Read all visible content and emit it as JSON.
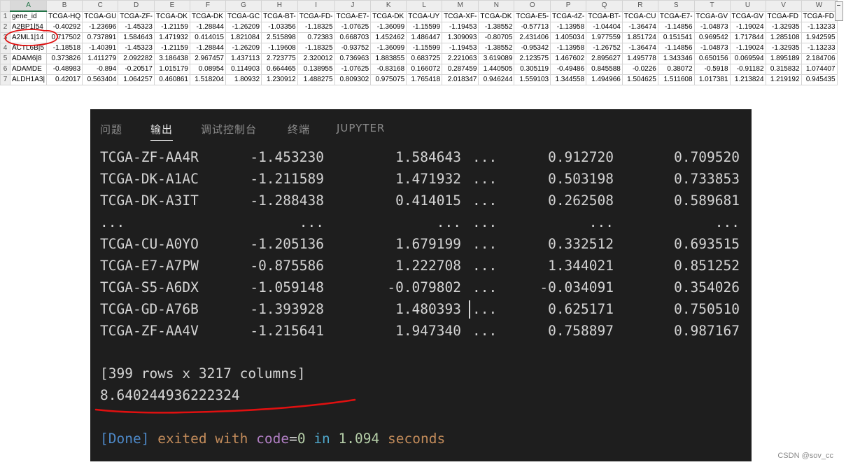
{
  "spreadsheet": {
    "columns": [
      "A",
      "B",
      "C",
      "D",
      "E",
      "F",
      "G",
      "H",
      "I",
      "J",
      "K",
      "L",
      "M",
      "N",
      "O",
      "P",
      "Q",
      "R",
      "S",
      "T",
      "U",
      "V",
      "W"
    ],
    "rows": [
      {
        "n": "1",
        "cells": [
          "gene_id",
          "TCGA-HQ",
          "TCGA-GU",
          "TCGA-ZF-",
          "TCGA-DK",
          "TCGA-DK",
          "TCGA-GC",
          "TCGA-BT-",
          "TCGA-FD-",
          "TCGA-E7-",
          "TCGA-DK",
          "TCGA-UY",
          "TCGA-XF-",
          "TCGA-DK",
          "TCGA-E5-",
          "TCGA-4Z-",
          "TCGA-BT-",
          "TCGA-CU",
          "TCGA-E7-",
          "TCGA-GV",
          "TCGA-GV",
          "TCGA-FD",
          "TCGA-FD"
        ]
      },
      {
        "n": "2",
        "cells": [
          "A2BP1|54",
          "-0.40292",
          "-1.23696",
          "-1.45323",
          "-1.21159",
          "-1.28844",
          "-1.26209",
          "-1.03356",
          "-1.18325",
          "-1.07625",
          "-1.36099",
          "-1.15599",
          "-1.19453",
          "-1.38552",
          "-0.57713",
          "-1.13958",
          "-1.04404",
          "-1.36474",
          "-1.14856",
          "-1.04873",
          "-1.19024",
          "-1.32935",
          "-1.13233"
        ]
      },
      {
        "n": "3",
        "cells": [
          "A2ML1|14",
          "0.717502",
          "0.737891",
          "1.584643",
          "1.471932",
          "0.414015",
          "1.821084",
          "2.515898",
          "0.72383",
          "0.668703",
          "1.452462",
          "1.486447",
          "1.309093",
          "-0.80705",
          "2.431406",
          "1.405034",
          "1.977559",
          "1.851724",
          "0.151541",
          "0.969542",
          "1.717844",
          "1.285108",
          "1.942595"
        ]
      },
      {
        "n": "4",
        "cells": [
          "ACTL6B|5",
          "-1.18518",
          "-1.40391",
          "-1.45323",
          "-1.21159",
          "-1.28844",
          "-1.26209",
          "-1.19608",
          "-1.18325",
          "-0.93752",
          "-1.36099",
          "-1.15599",
          "-1.19453",
          "-1.38552",
          "-0.95342",
          "-1.13958",
          "-1.26752",
          "-1.36474",
          "-1.14856",
          "-1.04873",
          "-1.19024",
          "-1.32935",
          "-1.13233"
        ]
      },
      {
        "n": "5",
        "cells": [
          "ADAM6|8",
          "0.373826",
          "1.411279",
          "2.092282",
          "3.186438",
          "2.967457",
          "1.437113",
          "2.723775",
          "2.320012",
          "0.736963",
          "1.883855",
          "0.683725",
          "2.221063",
          "3.619089",
          "2.123575",
          "1.467602",
          "2.895627",
          "1.495778",
          "1.343346",
          "0.650156",
          "0.069594",
          "1.895189",
          "2.184706"
        ]
      },
      {
        "n": "6",
        "cells": [
          "ADAMDE",
          "-0.48983",
          "-0.894",
          "-0.20517",
          "1.015179",
          "0.08954",
          "0.114903",
          "0.664465",
          "0.138955",
          "-1.07625",
          "-0.83168",
          "0.166072",
          "0.287459",
          "1.440505",
          "0.305119",
          "-0.49486",
          "0.845588",
          "-0.0226",
          "0.38072",
          "-0.5918",
          "-0.91182",
          "0.315832",
          "1.074407"
        ]
      },
      {
        "n": "7",
        "cells": [
          "ALDH1A3|",
          "0.42017",
          "0.563404",
          "1.064257",
          "0.460861",
          "1.518204",
          "1.80932",
          "1.230912",
          "1.488275",
          "0.809302",
          "0.975075",
          "1.765418",
          "2.018347",
          "0.946244",
          "1.559103",
          "1.344558",
          "1.494966",
          "1.504625",
          "1.511608",
          "1.017381",
          "1.213824",
          "1.219192",
          "0.945435"
        ]
      }
    ]
  },
  "panel": {
    "tabs": [
      "问题",
      "输出",
      "调试控制台",
      "终端",
      "JUPYTER"
    ],
    "active_tab": "输出",
    "rows": [
      {
        "id": "TCGA-ZF-AA4R",
        "c1": "-1.453230",
        "c2": "1.584643",
        "dots": "...",
        "c4": "0.912720",
        "c5": "0.709520"
      },
      {
        "id": "TCGA-DK-A1AC",
        "c1": "-1.211589",
        "c2": "1.471932",
        "dots": "...",
        "c4": "0.503198",
        "c5": "0.733853"
      },
      {
        "id": "TCGA-DK-A3IT",
        "c1": "-1.288438",
        "c2": "0.414015",
        "dots": "...",
        "c4": "0.262508",
        "c5": "0.589681"
      },
      {
        "id": "...",
        "c1": "...",
        "c2": "...",
        "dots": "...",
        "c4": "...",
        "c5": "..."
      },
      {
        "id": "TCGA-CU-A0YO",
        "c1": "-1.205136",
        "c2": "1.679199",
        "dots": "...",
        "c4": "0.332512",
        "c5": "0.693515"
      },
      {
        "id": "TCGA-E7-A7PW",
        "c1": "-0.875586",
        "c2": "1.222708",
        "dots": "...",
        "c4": "1.344021",
        "c5": "0.851252"
      },
      {
        "id": "TCGA-S5-A6DX",
        "c1": "-1.059148",
        "c2": "-0.079802",
        "dots": "...",
        "c4": "-0.034091",
        "c5": "0.354026"
      },
      {
        "id": "TCGA-GD-A76B",
        "c1": "-1.393928",
        "c2": "1.480393",
        "dots": "...",
        "c4": "0.625171",
        "c5": "0.750510"
      },
      {
        "id": "TCGA-ZF-AA4V",
        "c1": "-1.215641",
        "c2": "1.947340",
        "dots": "...",
        "c4": "0.758897",
        "c5": "0.987167"
      }
    ],
    "shape_line": "[399 rows x 3217 columns]",
    "result_value": "8.640244936222324",
    "done": {
      "tag": "[Done]",
      "exited": "exited with",
      "code": "code",
      "eq": "=",
      "zero": "0",
      "in": "in",
      "seconds_value": "1.094",
      "seconds_label": "seconds"
    }
  },
  "watermark": "CSDN @sov_cc",
  "colors": {
    "panel_bg": "#1e1e1e",
    "annotation_red": "#e01010",
    "excel_green": "#217346"
  }
}
